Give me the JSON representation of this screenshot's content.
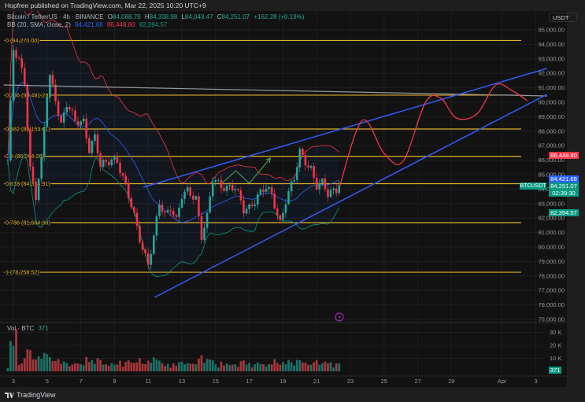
{
  "header": {
    "published": "Hopfree published on TradingView.com, Mar 22, 2025 10:20 UTC+9"
  },
  "legend": {
    "symbol": "Bitcoin / TetherUS · 4h · BINANCE",
    "o_label": "O",
    "o": "84,088.79",
    "h_label": "H",
    "h": "84,338.98",
    "l_label": "L",
    "l": "84,043.47",
    "c_label": "C",
    "c": "84,251.07",
    "change": "+162.28 (+0.19%)",
    "bb_label": "BB (20, SMA, close, 2)",
    "bb_basis": "84,421.68",
    "bb_upper": "86,448.80",
    "bb_lower": "82,394.57"
  },
  "price_axis": {
    "currency": "USDT",
    "labels": [
      "95,000.00",
      "94,000.00",
      "93,000.00",
      "92,000.00",
      "91,000.00",
      "90,000.00",
      "89,000.00",
      "88,000.00",
      "87,000.00",
      "86,000.00",
      "85,000.00",
      "84,000.00",
      "83,000.00",
      "82,000.00",
      "81,000.00",
      "80,000.00",
      "79,000.00",
      "78,000.00",
      "77,000.00",
      "76,000.00",
      "75,000.00"
    ],
    "range": [
      75000,
      95000
    ]
  },
  "badges": {
    "bb_upper": "86,448.80",
    "bb_basis": "84,421.68",
    "last_price": "84,251.07",
    "countdown": "02:39:30",
    "bb_lower": "82,394.57",
    "symbol_tag": "BTCUSDT"
  },
  "time_axis": {
    "labels": [
      {
        "text": "3",
        "date": "2025-03-03T00:00"
      },
      {
        "text": "5",
        "date": "2025-03-05T00:00"
      },
      {
        "text": "7",
        "date": "2025-03-07T00:00"
      },
      {
        "text": "9",
        "date": "2025-03-09T00:00"
      },
      {
        "text": "11",
        "date": "2025-03-11T00:00"
      },
      {
        "text": "13",
        "date": "2025-03-13T00:00"
      },
      {
        "text": "15",
        "date": "2025-03-15T00:00"
      },
      {
        "text": "17",
        "date": "2025-03-17T00:00"
      },
      {
        "text": "19",
        "date": "2025-03-19T00:00"
      },
      {
        "text": "21",
        "date": "2025-03-21T00:00"
      },
      {
        "text": "23",
        "date": "2025-03-23T00:00"
      },
      {
        "text": "25",
        "date": "2025-03-25T00:00"
      },
      {
        "text": "27",
        "date": "2025-03-27T00:00"
      },
      {
        "text": "29",
        "date": "2025-03-29T00:00"
      },
      {
        "text": "Apr",
        "date": "2025-04-01T00:00"
      },
      {
        "text": "3",
        "date": "2025-04-03T00:00"
      }
    ]
  },
  "fib_levels": [
    {
      "label": "0 (94,270.00)",
      "price": 94270.0
    },
    {
      "label": "0.236 (90,491.29)",
      "price": 90491.29
    },
    {
      "label": "0.382 (88,153.61)",
      "price": 88153.61
    },
    {
      "label": "0.5 (86,264.26)",
      "price": 86264.26
    },
    {
      "label": "0.618 (84,374.91)",
      "price": 84374.91
    },
    {
      "label": "0.786 (81,684.98)",
      "price": 81684.98
    },
    {
      "label": "1 (78,258.52)",
      "price": 78258.52
    }
  ],
  "volume": {
    "label": "Vol · BTC",
    "value": "371",
    "axis_labels": [
      {
        "text": "30 K",
        "v": 30000
      },
      {
        "text": "20 K",
        "v": 20000
      },
      {
        "text": "10 K",
        "v": 10000
      }
    ]
  },
  "chart_data": {
    "type": "candlestick",
    "interval": "4h",
    "price_path": [
      [
        "2025-03-02T16:00",
        86000
      ],
      [
        "2025-03-03T00:00",
        93500
      ],
      [
        "2025-03-03T08:00",
        92800
      ],
      [
        "2025-03-03T16:00",
        91500
      ],
      [
        "2025-03-04T00:00",
        85500
      ],
      [
        "2025-03-04T08:00",
        83500
      ],
      [
        "2025-03-04T16:00",
        85800
      ],
      [
        "2025-03-05T00:00",
        90500
      ],
      [
        "2025-03-05T04:00",
        91800
      ],
      [
        "2025-03-05T12:00",
        90400
      ],
      [
        "2025-03-05T20:00",
        88500
      ],
      [
        "2025-03-06T04:00",
        89800
      ],
      [
        "2025-03-06T16:00",
        88600
      ],
      [
        "2025-03-07T04:00",
        88800
      ],
      [
        "2025-03-07T12:00",
        86800
      ],
      [
        "2025-03-07T20:00",
        87500
      ],
      [
        "2025-03-08T04:00",
        85500
      ],
      [
        "2025-03-08T20:00",
        86200
      ],
      [
        "2025-03-09T04:00",
        86000
      ],
      [
        "2025-03-09T16:00",
        84000
      ],
      [
        "2025-03-10T00:00",
        82800
      ],
      [
        "2025-03-10T08:00",
        81500
      ],
      [
        "2025-03-10T16:00",
        80000
      ],
      [
        "2025-03-11T00:00",
        78800
      ],
      [
        "2025-03-11T08:00",
        80500
      ],
      [
        "2025-03-11T16:00",
        83000
      ],
      [
        "2025-03-12T00:00",
        82300
      ],
      [
        "2025-03-12T08:00",
        82900
      ],
      [
        "2025-03-12T16:00",
        81800
      ],
      [
        "2025-03-13T00:00",
        83400
      ],
      [
        "2025-03-13T08:00",
        83800
      ],
      [
        "2025-03-13T20:00",
        83500
      ],
      [
        "2025-03-14T04:00",
        80800
      ],
      [
        "2025-03-14T12:00",
        82000
      ],
      [
        "2025-03-14T20:00",
        84600
      ],
      [
        "2025-03-15T08:00",
        84300
      ],
      [
        "2025-03-15T20:00",
        84200
      ],
      [
        "2025-03-16T04:00",
        84000
      ],
      [
        "2025-03-16T16:00",
        82500
      ],
      [
        "2025-03-17T00:00",
        82800
      ],
      [
        "2025-03-17T12:00",
        83600
      ],
      [
        "2025-03-18T00:00",
        84000
      ],
      [
        "2025-03-18T08:00",
        83500
      ],
      [
        "2025-03-18T20:00",
        81800
      ],
      [
        "2025-03-19T04:00",
        83300
      ],
      [
        "2025-03-19T16:00",
        84600
      ],
      [
        "2025-03-20T00:00",
        86500
      ],
      [
        "2025-03-20T08:00",
        86000
      ],
      [
        "2025-03-20T16:00",
        85500
      ],
      [
        "2025-03-21T00:00",
        84200
      ],
      [
        "2025-03-21T08:00",
        84300
      ],
      [
        "2025-03-21T16:00",
        83600
      ],
      [
        "2025-03-22T00:00",
        84000
      ],
      [
        "2025-03-22T08:00",
        84251.07
      ]
    ],
    "indicator": "BB (20, SMA, close, 2)",
    "drawings": {
      "wedge_upper": [
        [
          "2025-03-10T17:00",
          84130
        ],
        [
          "2025-04-03T16:00",
          92337
        ]
      ],
      "wedge_lower": [
        [
          "2025-03-11T09:00",
          76522
        ],
        [
          "2025-04-03T16:00",
          90543
        ]
      ],
      "grey_line": [
        [
          "2025-03-02T10:00",
          91196
        ],
        [
          "2025-04-03T16:00",
          90435
        ]
      ],
      "projection": [
        [
          "2025-03-22T09:00",
          84239
        ],
        [
          "2025-03-23T17:00",
          88750
        ],
        [
          "2025-03-25T00:00",
          86467
        ],
        [
          "2025-03-26T03:00",
          85924
        ],
        [
          "2025-03-27T11:00",
          90000
        ],
        [
          "2025-03-28T09:00",
          90272
        ],
        [
          "2025-03-29T07:00",
          88913
        ],
        [
          "2025-03-30T12:00",
          89185
        ],
        [
          "2025-03-31T15:00",
          91196
        ],
        [
          "2025-04-01T14:00",
          90815
        ],
        [
          "2025-04-02T12:00",
          90109
        ]
      ],
      "green_zigzag": [
        [
          "2025-03-15T10:00",
          84457
        ],
        [
          "2025-03-16T05:00",
          85272
        ],
        [
          "2025-03-17T00:00",
          84402
        ],
        [
          "2025-03-18T06:00",
          86141
        ]
      ]
    },
    "colors": {
      "up": "#26a69a",
      "down": "#f23645",
      "bb_basis": "#2962ff",
      "bb_upper": "#f23645",
      "bb_lower": "#089981",
      "fib": "#e0b12c",
      "wedge": "#2f5cf5",
      "projection": "#f23645",
      "zigzag": "#4caf50",
      "grid": "#1f1f1f"
    }
  },
  "footer": {
    "brand": "TradingView"
  }
}
